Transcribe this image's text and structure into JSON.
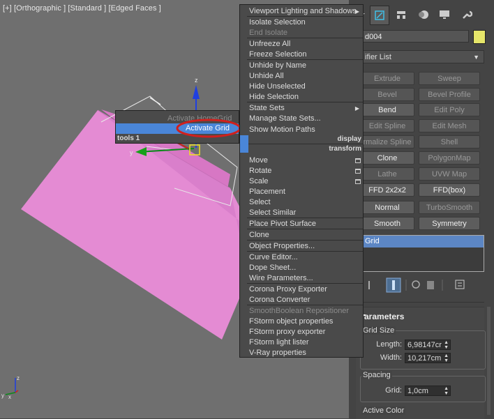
{
  "viewport": {
    "label": "[+] [Orthographic ] [Standard ] [Edged Faces ]",
    "axis_labels": {
      "x": "x",
      "y": "y",
      "z": "z"
    },
    "object_color": "#e48bd3"
  },
  "command_panel": {
    "object_name": "d004",
    "object_color": "#e6e66a",
    "modifier_list": "ifier List",
    "buttons": [
      {
        "label": "Extrude",
        "enabled": false
      },
      {
        "label": "Sweep",
        "enabled": false
      },
      {
        "label": "Bevel",
        "enabled": false
      },
      {
        "label": "Bevel Profile",
        "enabled": false
      },
      {
        "label": "Bend",
        "enabled": true
      },
      {
        "label": "Edit Poly",
        "enabled": false
      },
      {
        "label": "Edit Spline",
        "enabled": false
      },
      {
        "label": "Edit Mesh",
        "enabled": false
      },
      {
        "label": "rmalize Spline",
        "enabled": false
      },
      {
        "label": "Shell",
        "enabled": false
      },
      {
        "label": "Clone",
        "enabled": true
      },
      {
        "label": "PolygonMap",
        "enabled": false
      },
      {
        "label": "Lathe",
        "enabled": false
      },
      {
        "label": "UVW Map",
        "enabled": false
      },
      {
        "label": "FFD 2x2x2",
        "enabled": true
      },
      {
        "label": "FFD(box)",
        "enabled": true
      },
      {
        "label": "Normal",
        "enabled": true
      },
      {
        "label": "TurboSmooth",
        "enabled": false
      },
      {
        "label": "Smooth",
        "enabled": true
      },
      {
        "label": "Symmetry",
        "enabled": true
      }
    ],
    "stack_selected": "Grid",
    "rollout_title": "Parameters",
    "grid_size_label": "Grid Size",
    "length_label": "Length:",
    "length_value": "6,98147cr",
    "width_label": "Width:",
    "width_value": "10,217cm",
    "spacing_label": "Spacing",
    "grid_label": "Grid:",
    "grid_value": "1,0cm",
    "active_color_label": "Active Color"
  },
  "left_menu": {
    "items": [
      "Activate HomeGrid",
      "Activate Grid"
    ],
    "highlighted": "Activate Grid",
    "section": "tools 1",
    "highlight_ring_color": "#d0201d"
  },
  "right_menu": {
    "items_display": [
      "Viewport Lighting and Shadows",
      "Isolate Selection",
      "End Isolate",
      "Unfreeze All",
      "Freeze Selection",
      "Unhide by Name",
      "Unhide All",
      "Hide Unselected",
      "Hide Selection",
      "State Sets",
      "Manage State Sets...",
      "Show Motion Paths"
    ],
    "section_display": "display",
    "section_transform": "transform",
    "items_transform": [
      "Move",
      "Rotate",
      "Scale",
      "Placement",
      "Select",
      "Select Similar",
      "Place Pivot Surface",
      "Clone",
      "Object Properties...",
      "Curve Editor...",
      "Dope Sheet...",
      "Wire Parameters...",
      "Corona Proxy Exporter",
      "Corona Converter",
      "SmoothBoolean Repositioner",
      "FStorm object properties",
      "FStorm proxy exporter",
      "FStorm light lister",
      "V-Ray properties"
    ],
    "highlight_color": "#4a86d8"
  }
}
